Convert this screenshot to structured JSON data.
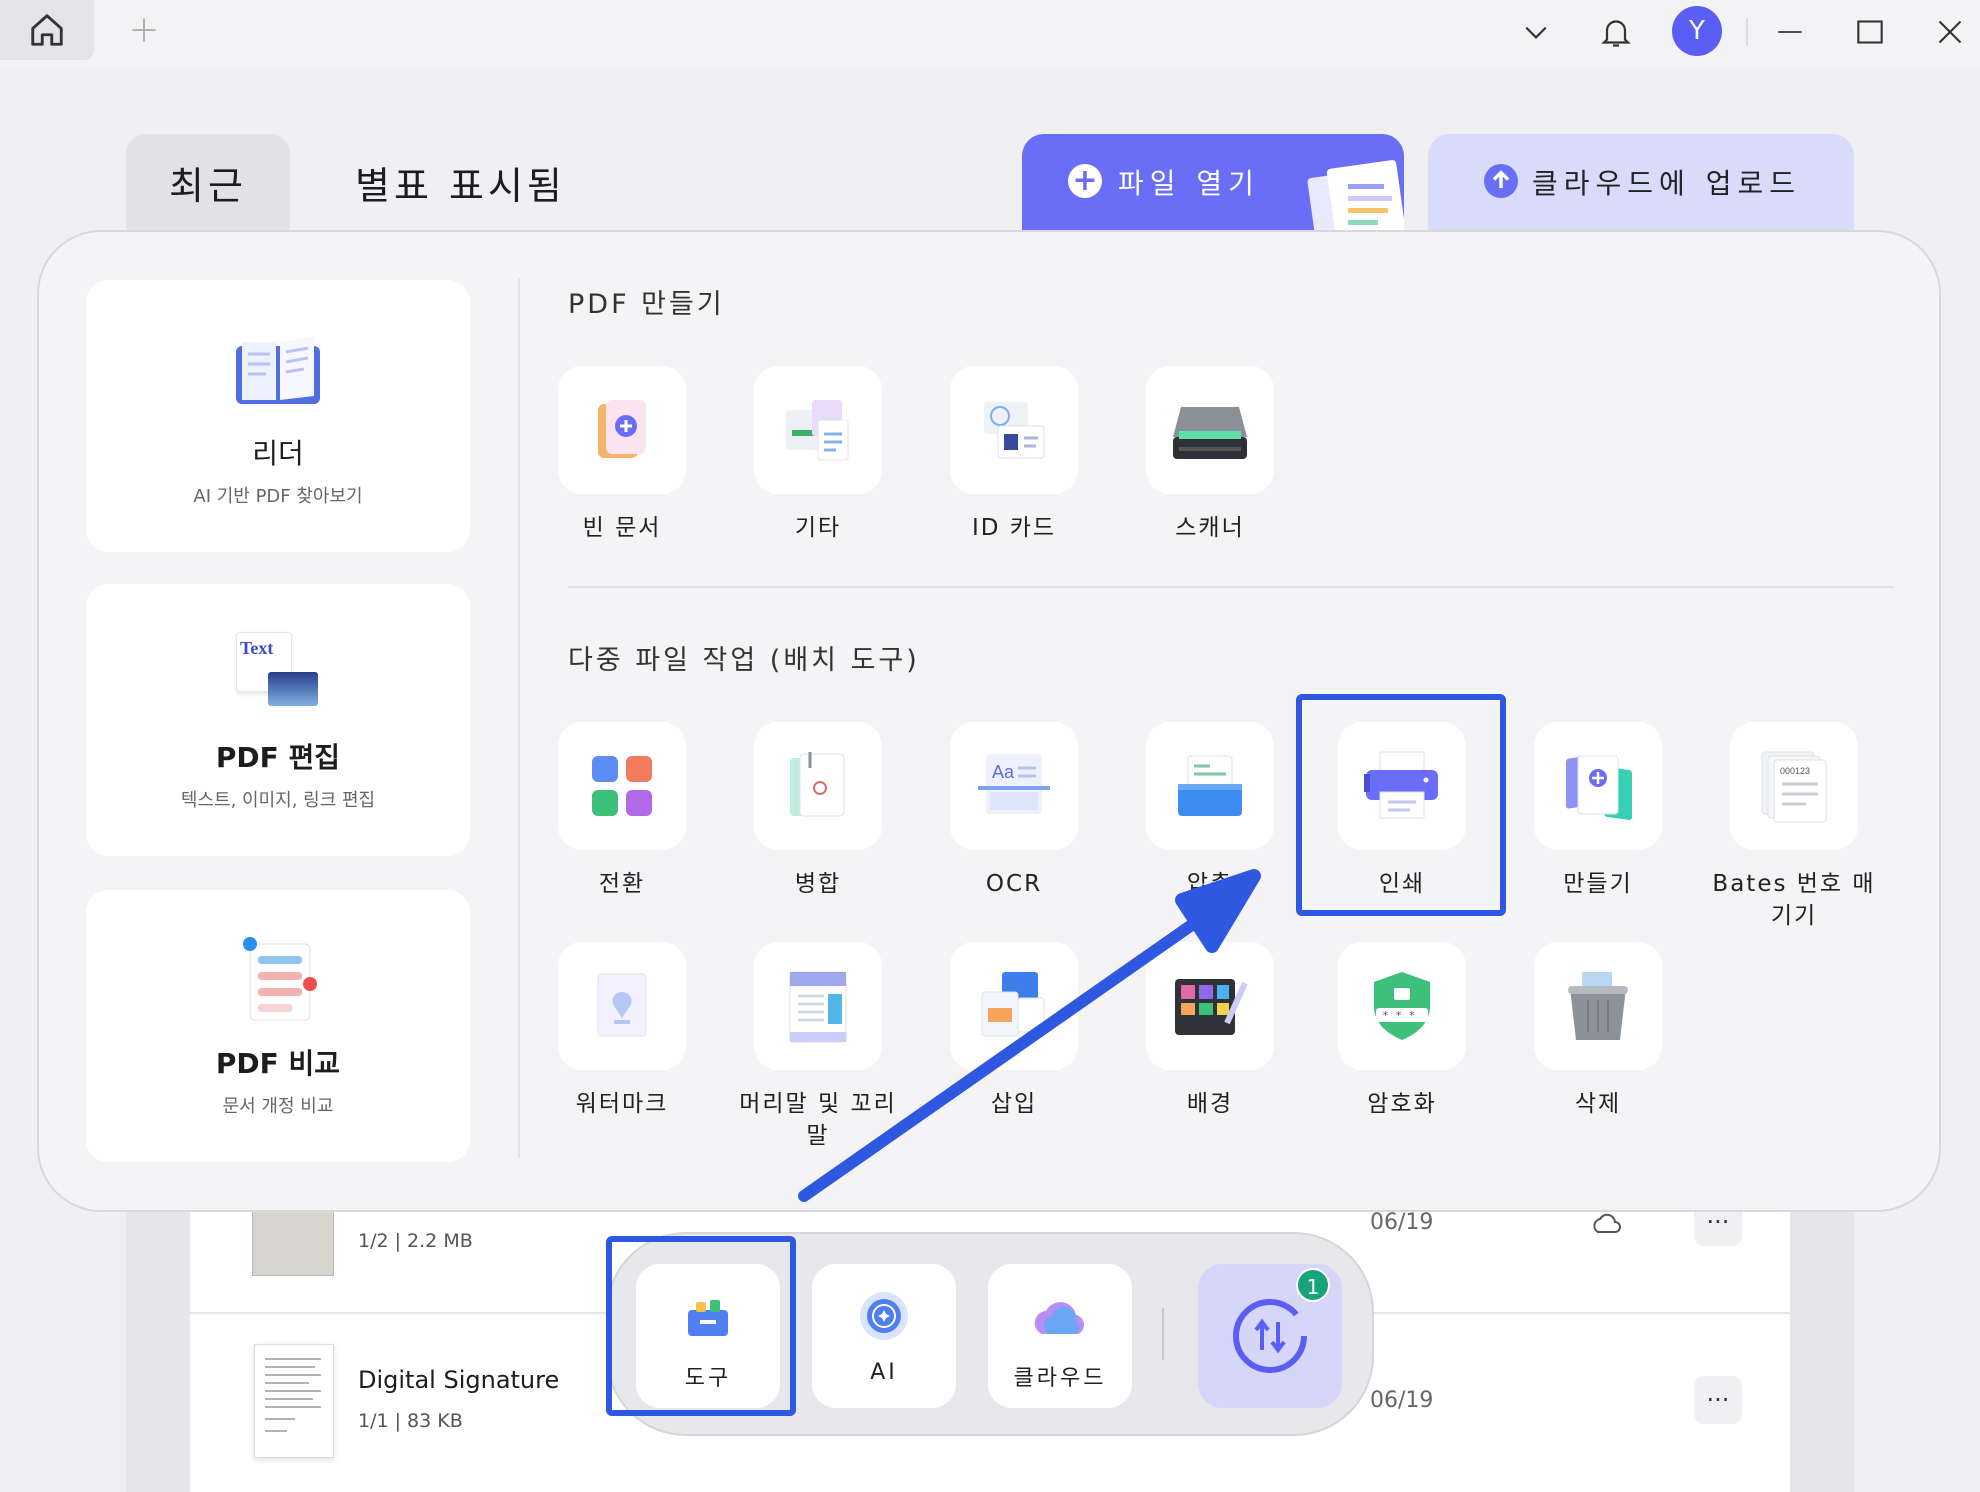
{
  "titlebar": {
    "avatar_initial": "Y"
  },
  "tabs": {
    "recent": "최근",
    "starred": "별표 표시됨"
  },
  "actions": {
    "open_file": "파일 열기",
    "upload_cloud": "클라우드에 업로드"
  },
  "left_cards": [
    {
      "title": "리더",
      "subtitle": "AI 기반 PDF 찾아보기"
    },
    {
      "title": "PDF 편집",
      "subtitle": "텍스트, 이미지, 링크 편집",
      "icon_text": "Text"
    },
    {
      "title": "PDF 비교",
      "subtitle": "문서 개정 비교"
    }
  ],
  "create_section": {
    "title": "PDF 만들기",
    "items": [
      "빈 문서",
      "기타",
      "ID 카드",
      "스캐너"
    ]
  },
  "batch_section": {
    "title": "다중 파일 작업 (배치 도구)",
    "row1": [
      "전환",
      "병합",
      "OCR",
      "압축",
      "인쇄",
      "만들기",
      "Bates 번호 매기기"
    ],
    "row2": [
      "워터마크",
      "머리말 및 꼬리말",
      "삽입",
      "배경",
      "암호화",
      "삭제"
    ]
  },
  "files": [
    {
      "name": "",
      "meta": "1/2 | 2.2 MB",
      "date": "06/19"
    },
    {
      "name": "Digital Signature",
      "meta": "1/1 | 83 KB",
      "date": "06/19"
    }
  ],
  "dock": {
    "tools": "도구",
    "ai": "AI",
    "cloud": "클라우드",
    "badge_count": "1"
  },
  "colors": {
    "accent": "#6a6ef6",
    "highlight": "#2f58e0",
    "badge": "#18a37a"
  }
}
